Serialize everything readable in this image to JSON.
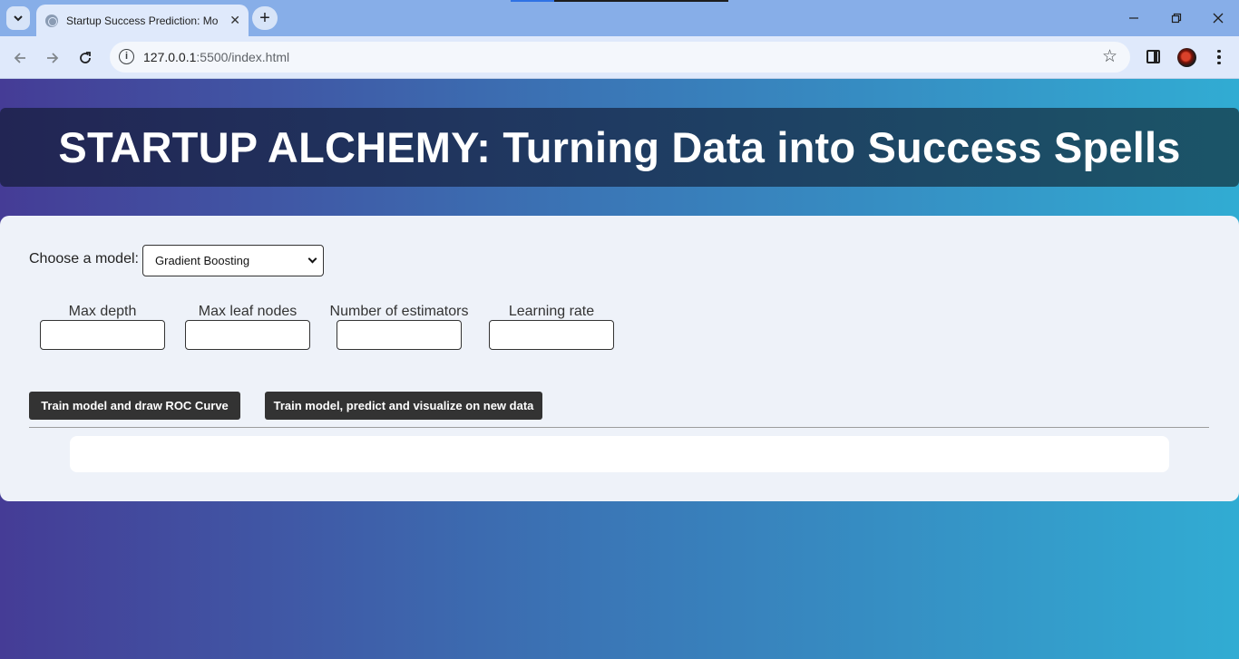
{
  "browser": {
    "tab_title": "Startup Success Prediction: Mo",
    "url_host": "127.0.0.1",
    "url_path": ":5500/index.html",
    "icons": {
      "tab_search": "chevron-down-icon",
      "tab_close": "close-icon",
      "new_tab": "plus-icon",
      "back": "arrow-left-icon",
      "forward": "arrow-right-icon",
      "reload": "reload-icon",
      "site_info": "info-icon",
      "bookmark": "star-icon",
      "side_panel": "side-panel-icon",
      "menu": "kebab-menu-icon"
    }
  },
  "page": {
    "heading": "STARTUP ALCHEMY: Turning Data into Success Spells",
    "model_label": "Choose a model:",
    "model_selected": "Gradient Boosting",
    "params": [
      {
        "label": "Max depth",
        "value": ""
      },
      {
        "label": "Max leaf nodes",
        "value": ""
      },
      {
        "label": "Number of estimators",
        "value": ""
      },
      {
        "label": "Learning rate",
        "value": ""
      }
    ],
    "buttons": {
      "roc": "Train model and draw ROC Curve",
      "predict": "Train model, predict and visualize on new data"
    },
    "colors": {
      "gradient_start": "#453c96",
      "gradient_end": "#31acd3",
      "banner_start": "#222554",
      "banner_end": "#1b5568",
      "button_bg": "#333333"
    }
  }
}
